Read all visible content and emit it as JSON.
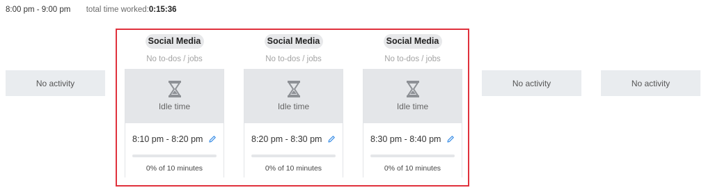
{
  "header": {
    "time_range": "8:00 pm - 9:00 pm",
    "total_label": "total time worked:",
    "total_value": "0:15:36"
  },
  "no_activity": [
    "No activity",
    "No activity",
    "No activity"
  ],
  "slots": [
    {
      "tag": "Social Media",
      "todo": "No to-dos / jobs",
      "status": "Idle time",
      "time": "8:10 pm - 8:20 pm",
      "percent_text": "0% of 10 minutes",
      "progress": 0
    },
    {
      "tag": "Social Media",
      "todo": "No to-dos / jobs",
      "status": "Idle time",
      "time": "8:20 pm - 8:30 pm",
      "percent_text": "0% of 10 minutes",
      "progress": 0
    },
    {
      "tag": "Social Media",
      "todo": "No to-dos / jobs",
      "status": "Idle time",
      "time": "8:30 pm - 8:40 pm",
      "percent_text": "0% of 10 minutes",
      "progress": 0
    }
  ],
  "colors": {
    "highlight": "#e0313c",
    "edit_icon": "#3a8ee6"
  },
  "icons": {
    "idle": "hourglass-icon",
    "edit": "pencil-icon"
  }
}
